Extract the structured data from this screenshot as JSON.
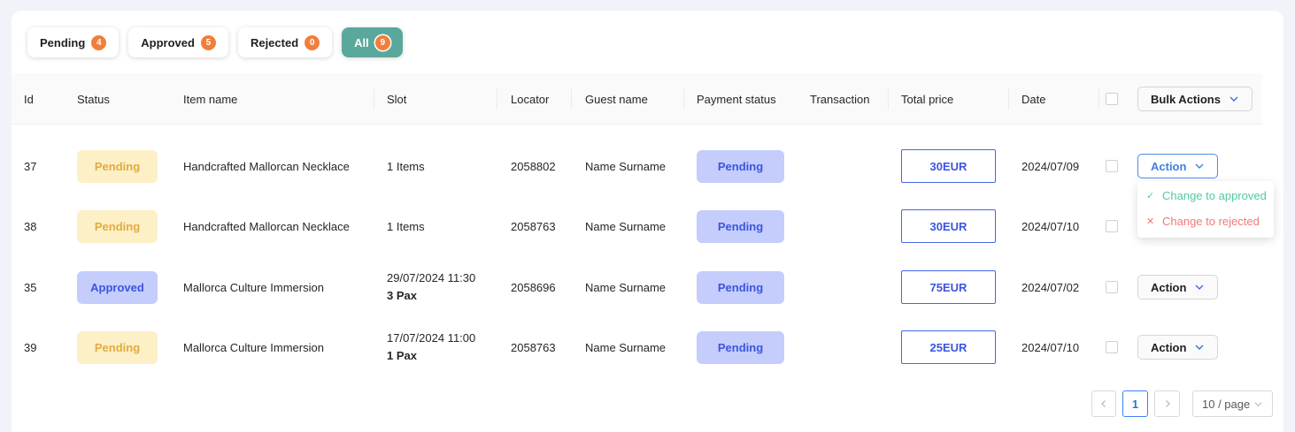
{
  "tabs": [
    {
      "label": "Pending",
      "count": "4"
    },
    {
      "label": "Approved",
      "count": "5"
    },
    {
      "label": "Rejected",
      "count": "0"
    },
    {
      "label": "All",
      "count": "9"
    }
  ],
  "columns": {
    "id": "Id",
    "status": "Status",
    "item_name": "Item name",
    "slot": "Slot",
    "locator": "Locator",
    "guest_name": "Guest name",
    "payment_status": "Payment status",
    "transaction": "Transaction",
    "total_price": "Total price",
    "date": "Date",
    "bulk_actions": "Bulk Actions"
  },
  "rows": [
    {
      "id": "37",
      "status": "Pending",
      "item": "Handcrafted Mallorcan Necklace",
      "slot": "1 Items",
      "slot_pax": "",
      "locator": "2058802",
      "guest": "Name Surname",
      "payment": "Pending",
      "transaction": "",
      "price": "30EUR",
      "date": "2024/07/09",
      "action": "Action"
    },
    {
      "id": "38",
      "status": "Pending",
      "item": "Handcrafted Mallorcan Necklace",
      "slot": "1 Items",
      "slot_pax": "",
      "locator": "2058763",
      "guest": "Name Surname",
      "payment": "Pending",
      "transaction": "",
      "price": "30EUR",
      "date": "2024/07/10",
      "action": "Action"
    },
    {
      "id": "35",
      "status": "Approved",
      "item": "Mallorca Culture Immersion",
      "slot": "29/07/2024 11:30",
      "slot_pax": "3 Pax",
      "locator": "2058696",
      "guest": "Name Surname",
      "payment": "Pending",
      "transaction": "",
      "price": "75EUR",
      "date": "2024/07/02",
      "action": "Action"
    },
    {
      "id": "39",
      "status": "Pending",
      "item": "Mallorca Culture Immersion",
      "slot": "17/07/2024 11:00",
      "slot_pax": "1 Pax",
      "locator": "2058763",
      "guest": "Name Surname",
      "payment": "Pending",
      "transaction": "",
      "price": "25EUR",
      "date": "2024/07/10",
      "action": "Action"
    }
  ],
  "dropdown": {
    "approve": "Change to approved",
    "reject": "Change to rejected"
  },
  "pagination": {
    "prev_icon": "chevron-left-icon",
    "current_page": "1",
    "next_icon": "chevron-right-icon",
    "page_size": "10 / page"
  },
  "colors": {
    "accent_teal": "#5aa89c",
    "count_orange": "#f07f3c",
    "pending_bg": "#fdefc6",
    "pending_text": "#e0ac40",
    "approved_bg": "#c4cdfb",
    "approved_text": "#3b55e0",
    "approve_green": "#55c7a3",
    "reject_red": "#f07a78"
  }
}
